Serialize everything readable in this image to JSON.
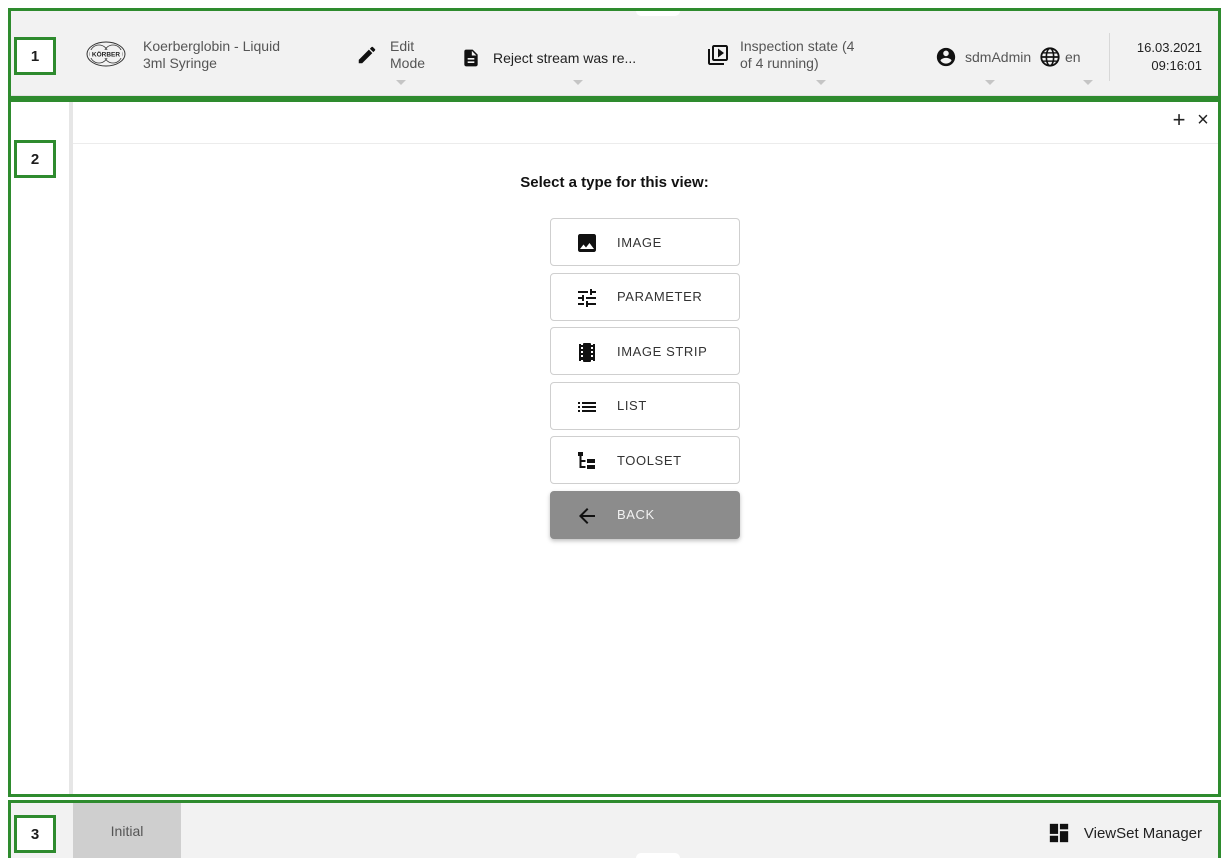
{
  "header": {
    "brand_logo_text": "KÖRBER",
    "product_line1": "Koerberglobin - Liquid",
    "product_line2": "3ml Syringe",
    "edit_line1": "Edit",
    "edit_line2": "Mode",
    "reject_message": "Reject stream was re...",
    "inspection_line1": "Inspection state (4",
    "inspection_line2": "of 4 running)",
    "user": "sdmAdmin",
    "language": "en",
    "date": "16.03.2021",
    "time": "09:16:01"
  },
  "regions": {
    "r1": "1",
    "r2": "2",
    "r3": "3"
  },
  "view": {
    "add_symbol": "+",
    "close_symbol": "×",
    "prompt": "Select a type for this view:",
    "types": [
      {
        "label": "IMAGE",
        "icon": "image-icon"
      },
      {
        "label": "PARAMETER",
        "icon": "sliders-icon"
      },
      {
        "label": "IMAGE STRIP",
        "icon": "film-strip-icon"
      },
      {
        "label": "LIST",
        "icon": "list-icon"
      },
      {
        "label": "TOOLSET",
        "icon": "tree-icon"
      }
    ],
    "back_label": "BACK"
  },
  "footer": {
    "tab_label": "Initial",
    "viewset_label": "ViewSet Manager"
  },
  "colors": {
    "annotation_green": "#2e8b2e",
    "header_bg": "#f2f2f2",
    "back_button_bg": "#8c8c8c",
    "active_tab_bg": "#cfcfcf"
  }
}
